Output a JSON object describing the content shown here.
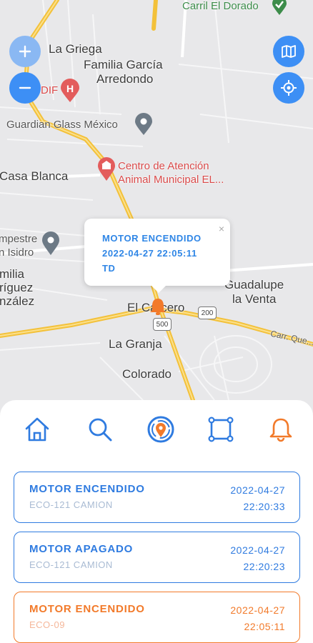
{
  "map": {
    "places": {
      "carril_el_dorado": "Carril El Dorado",
      "la_griega": "La Griega",
      "familia_garcia_1": "Familia García",
      "familia_garcia_2": "Arredondo",
      "dif": "DIF",
      "guardian": "Guardian Glass México",
      "casa_blanca": "Casa Blanca",
      "centro_1": "Centro de Atención",
      "centro_2": "Animal Municipal EL...",
      "campestre_1": "mpestre",
      "campestre_2": "n Isidro",
      "familia_rod_1": "milia",
      "familia_rod_2": "ríguez",
      "familia_rod_3": "nzález",
      "guadalupe_1": "Guadalupe",
      "guadalupe_2": "la Venta",
      "el_carcero": "El Carcero",
      "la_granja": "La Granja",
      "colorado": "Colorado",
      "carr_que": "Carr. Que..."
    },
    "road_badges": {
      "b200": "200",
      "b500": "500"
    },
    "controls": {
      "zoom_in": "+",
      "zoom_out": "−"
    },
    "popup": {
      "line1": "MOTOR ENCENDIDO",
      "line2": "2022-04-27 22:05:11",
      "line3": "TD",
      "close": "×"
    }
  },
  "nav": {
    "items": [
      "home",
      "search",
      "track",
      "geofence",
      "alerts"
    ]
  },
  "events": [
    {
      "title": "MOTOR ENCENDIDO",
      "vehicle": "ECO-121 CAMION",
      "date": "2022-04-27",
      "time": "22:20:33",
      "color": "#2f7be0"
    },
    {
      "title": "MOTOR APAGADO",
      "vehicle": "ECO-121 CAMION",
      "date": "2022-04-27",
      "time": "22:20:23",
      "color": "#2f7be0"
    },
    {
      "title": "MOTOR ENCENDIDO",
      "vehicle": "ECO-09",
      "date": "2022-04-27",
      "time": "22:05:11",
      "color": "#f27a2a"
    }
  ],
  "colors": {
    "accent_blue": "#3d8ff5",
    "accent_orange": "#f27a2a",
    "road_yellow": "#f3c13a"
  }
}
